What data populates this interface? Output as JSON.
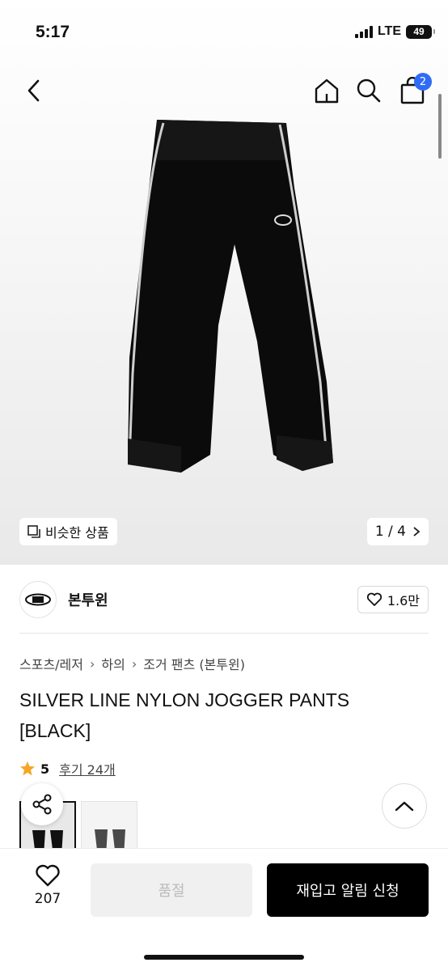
{
  "status": {
    "time": "5:17",
    "network": "LTE",
    "battery": "49"
  },
  "nav": {
    "cart_count": "2"
  },
  "image": {
    "similar_label": "비슷한 상품",
    "page_indicator": "1 / 4"
  },
  "brand": {
    "name": "본투윈",
    "likes": "1.6만"
  },
  "breadcrumb": [
    "스포츠/레저",
    "하의",
    "조거 팬츠 (본투윈)"
  ],
  "product": {
    "title": "SILVER LINE NYLON JOGGER PANTS [BLACK]",
    "rating": "5",
    "reviews": "후기 24개"
  },
  "bottom": {
    "wish_count": "207",
    "soldout_label": "품절",
    "restock_label": "재입고 알림 신청"
  },
  "colors": {
    "accent": "#2f6cf6",
    "star": "#f5a623"
  }
}
